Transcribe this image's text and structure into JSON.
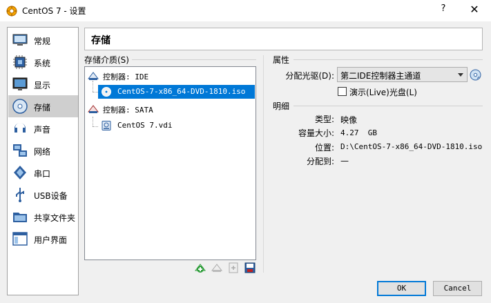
{
  "window": {
    "title": "CentOS 7 - 设置",
    "help_label": "?",
    "close_label": "✕",
    "icon": "virtualbox-icon"
  },
  "sidebar": {
    "items": [
      {
        "label": "常规",
        "icon": "general-icon"
      },
      {
        "label": "系统",
        "icon": "system-icon"
      },
      {
        "label": "显示",
        "icon": "display-icon"
      },
      {
        "label": "存储",
        "icon": "storage-icon",
        "selected": true
      },
      {
        "label": "声音",
        "icon": "audio-icon"
      },
      {
        "label": "网络",
        "icon": "network-icon"
      },
      {
        "label": "串口",
        "icon": "serial-port-icon"
      },
      {
        "label": "USB设备",
        "icon": "usb-icon"
      },
      {
        "label": "共享文件夹",
        "icon": "shared-folder-icon"
      },
      {
        "label": "用户界面",
        "icon": "user-interface-icon"
      }
    ]
  },
  "header": {
    "title": "存储"
  },
  "storage": {
    "label": "存储介质(S)",
    "tree": {
      "controller_ide": "控制器: IDE",
      "ide_disc": "CentOS-7-x86_64-DVD-1810.iso",
      "controller_sata": "控制器: SATA",
      "sata_disk": "CentOS 7.vdi"
    }
  },
  "attributes": {
    "label": "属性",
    "drive_label": "分配光驱(D):",
    "drive_value": "第二IDE控制器主通道",
    "live_cd_label": "演示(Live)光盘(L)",
    "live_cd_checked": false
  },
  "details": {
    "label": "明细",
    "type_label": "类型:",
    "type_value": "映像",
    "size_label": "容量大小:",
    "size_value": "4.27  GB",
    "location_label": "位置:",
    "location_value": "D:\\CentOS-7-x86_64-DVD-1810.iso",
    "attached_label": "分配到:",
    "attached_value": "—"
  },
  "buttons": {
    "ok": "OK",
    "cancel": "Cancel"
  },
  "colors": {
    "selection": "#0078d7",
    "sidebar_selected": "#cfcfcf",
    "add_icon": "#2e9d3a",
    "remove_icon": "#c02020"
  }
}
